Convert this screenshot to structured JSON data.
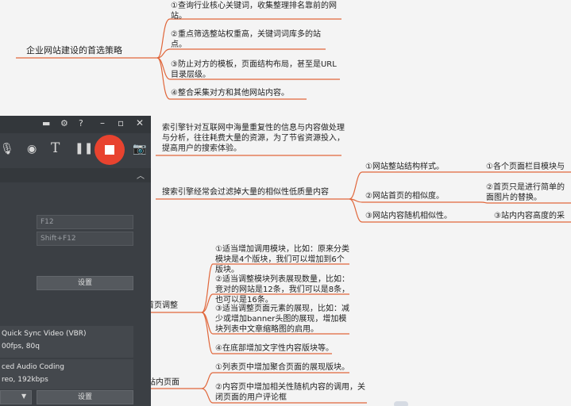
{
  "colors": {
    "accent_line": "#e0663a",
    "recorder_bg": "#3b3f44",
    "record_red": "#e8432f"
  },
  "mindmap": {
    "topic1": {
      "label": "企业网站建设的首选策略",
      "children": [
        "①查询行业核心关键词，收集整理排名靠前的网站。",
        "②重点筛选整站权重高，关键词词库多的站点。",
        "③防止对方的模板，页面结构布局，甚至是URL目录层级。",
        "④整合采集对方和其他网站内容。"
      ]
    },
    "note": "索引擎针对互联网中海量重复性的信息与内容做处理与分析，往往耗费大量的资源，为了节省资源投入，提高用户的搜索体验。",
    "topic2": {
      "label": "搜索引擎经常会过滤掉大量的相似性低质量内容",
      "children": [
        {
          "label": "①网站整站结构样式。",
          "detail": "①各个页面栏目模块与"
        },
        {
          "label": "②网站首页的相似度。",
          "detail": "②首页只是进行简单的面图片的替换。"
        },
        {
          "label": "③网站内容随机相似性。",
          "detail": "③站内内容高度的采"
        }
      ]
    },
    "topic3": {
      "label": "首页调整",
      "children": [
        "①适当增加调用模块，比如：原来分类模块是4个版块，我们可以增加到6个版块。",
        "②适当调整模块列表展现数量，比如：竞对的网站是12条，我们可以是8条，也可以是16条。",
        "③适当调整页面元素的展现，比如：减少或增加banner头图的展现，增加模块列表中文章缩略图的启用。",
        "④在底部增加文字性内容版块等。"
      ]
    },
    "topic4": {
      "label": "站内页面",
      "children": [
        "①列表页中增加聚合页面的展现版块。",
        "②内容页中增加相关性随机内容的调用，关闭页面的用户评论框"
      ]
    }
  },
  "recorder": {
    "hotkeys": [
      "F12",
      "Shift+F12"
    ],
    "settings_label": "设置",
    "video_codec": "Quick Sync Video (VBR)",
    "video_detail": "00fps, 80q",
    "audio_codec": "ced Audio Coding",
    "audio_detail": "reo, 192kbps",
    "settings_label_2": "设置"
  }
}
